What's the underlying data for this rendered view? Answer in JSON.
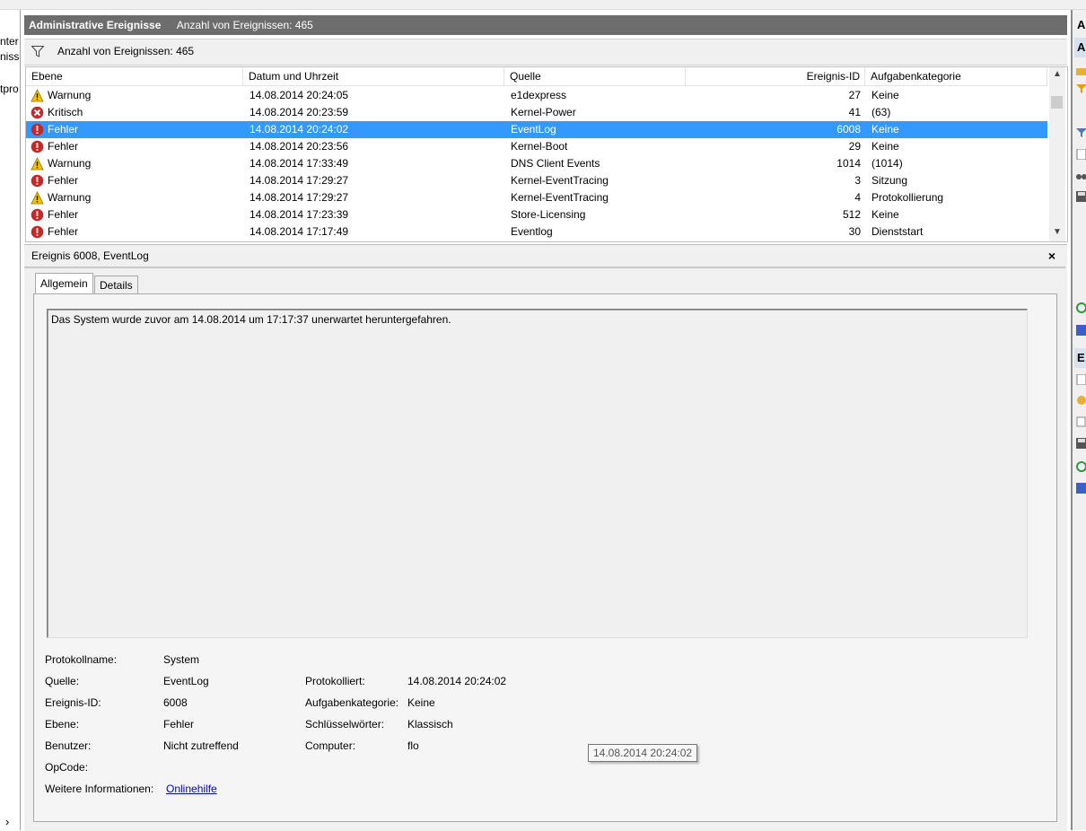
{
  "left_pane": {
    "items": [
      "nter",
      "nisse",
      "tpro"
    ],
    "collapse_glyph": "›"
  },
  "right_pane": {
    "header_a": "A",
    "header_b": "E"
  },
  "title_bar": {
    "title": "Administrative Ereignisse",
    "count_label": "Anzahl von Ereignissen: 465"
  },
  "filter_bar": {
    "icon": "filter-icon",
    "label": "Anzahl von Ereignissen: 465"
  },
  "table": {
    "columns": [
      "Ebene",
      "Datum und Uhrzeit",
      "Quelle",
      "Ereignis-ID",
      "Aufgabenkategorie"
    ],
    "selected_index": 2,
    "rows": [
      {
        "level": "Warnung",
        "icon": "warning-icon",
        "datetime": "14.08.2014 20:24:05",
        "source": "e1dexpress",
        "event_id": "27",
        "category": "Keine"
      },
      {
        "level": "Kritisch",
        "icon": "critical-icon",
        "datetime": "14.08.2014 20:23:59",
        "source": "Kernel-Power",
        "event_id": "41",
        "category": "(63)"
      },
      {
        "level": "Fehler",
        "icon": "error-icon",
        "datetime": "14.08.2014 20:24:02",
        "source": "EventLog",
        "event_id": "6008",
        "category": "Keine"
      },
      {
        "level": "Fehler",
        "icon": "error-icon",
        "datetime": "14.08.2014 20:23:56",
        "source": "Kernel-Boot",
        "event_id": "29",
        "category": "Keine"
      },
      {
        "level": "Warnung",
        "icon": "warning-icon",
        "datetime": "14.08.2014 17:33:49",
        "source": "DNS Client Events",
        "event_id": "1014",
        "category": "(1014)"
      },
      {
        "level": "Fehler",
        "icon": "error-icon",
        "datetime": "14.08.2014 17:29:27",
        "source": "Kernel-EventTracing",
        "event_id": "3",
        "category": "Sitzung"
      },
      {
        "level": "Warnung",
        "icon": "warning-icon",
        "datetime": "14.08.2014 17:29:27",
        "source": "Kernel-EventTracing",
        "event_id": "4",
        "category": "Protokollierung"
      },
      {
        "level": "Fehler",
        "icon": "error-icon",
        "datetime": "14.08.2014 17:23:39",
        "source": "Store-Licensing",
        "event_id": "512",
        "category": "Keine"
      },
      {
        "level": "Fehler",
        "icon": "error-icon",
        "datetime": "14.08.2014 17:17:49",
        "source": "Eventlog",
        "event_id": "30",
        "category": "Dienststart"
      }
    ]
  },
  "detail": {
    "title": "Ereignis 6008, EventLog",
    "close_glyph": "×",
    "tabs": [
      "Allgemein",
      "Details"
    ],
    "description": "Das System wurde zuvor am 14.08.2014 um 17:17:37 unerwartet heruntergefahren.",
    "props": {
      "log_name_label": "Protokollname:",
      "log_name": "System",
      "source_label": "Quelle:",
      "source": "EventLog",
      "logged_label": "Protokolliert:",
      "logged": "14.08.2014 20:24:02",
      "event_id_label": "Ereignis-ID:",
      "event_id": "6008",
      "category_label": "Aufgabenkategorie:",
      "category": "Keine",
      "level_label": "Ebene:",
      "level": "Fehler",
      "keywords_label": "Schlüsselwörter:",
      "keywords": "Klassisch",
      "user_label": "Benutzer:",
      "user": "Nicht zutreffend",
      "computer_label": "Computer:",
      "computer": "flo",
      "opcode_label": "OpCode:",
      "opcode": "",
      "more_info_label": "Weitere Informationen:",
      "more_info_link": "Onlinehilfe"
    },
    "tooltip": "14.08.2014 20:24:02"
  },
  "colors": {
    "selection": "#3399ff",
    "title_bar": "#6d6d6d",
    "warning": "#f5c400",
    "error": "#c62828",
    "link": "#0000cc"
  }
}
